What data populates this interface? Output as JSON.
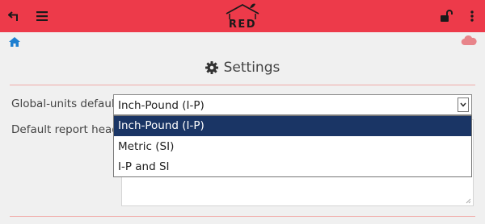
{
  "topbar": {
    "color": "#ed3a4a",
    "back_icon": "undo-arrow-icon",
    "menu_icon": "hamburger-menu-icon",
    "logo_text": "RED",
    "lock_icon": "unlocked-padlock-icon",
    "more_icon": "vertical-dots-icon"
  },
  "breadcrumb": {
    "home_icon": "home-icon",
    "cloud_icon": "cloud-icon"
  },
  "page": {
    "title": "Settings",
    "title_icon": "gear-icon"
  },
  "form": {
    "global_units_label": "Global-units default",
    "global_units_value": "Inch-Pound (I-P)",
    "report_header_label": "Default report heade",
    "options": [
      "Inch-Pound (I-P)",
      "Metric (SI)",
      "I-P and SI"
    ],
    "selected_index": 0,
    "highlight_color": "#1a3565"
  }
}
